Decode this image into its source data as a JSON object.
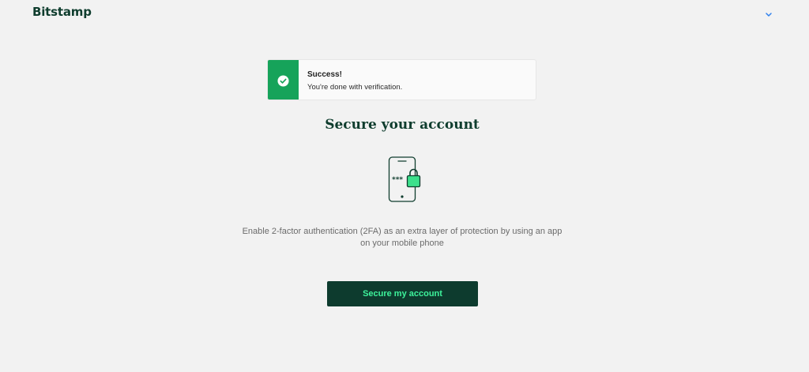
{
  "header": {
    "logo_text": "Bitstamp",
    "menu_icon": "chevron-down-icon"
  },
  "alert": {
    "title": "Success!",
    "message": "You're done with verification.",
    "icon": "check-circle-icon",
    "accent_color": "#16a35a"
  },
  "main": {
    "heading": "Secure your account",
    "illustration": "phone-lock-icon",
    "description": "Enable 2-factor authentication (2FA) as an extra layer of protection by using an app on your mobile phone",
    "button_label": "Secure my account"
  },
  "colors": {
    "brand_dark": "#0d3b2e",
    "brand_green": "#3df29b",
    "background": "#f2f2f2"
  }
}
